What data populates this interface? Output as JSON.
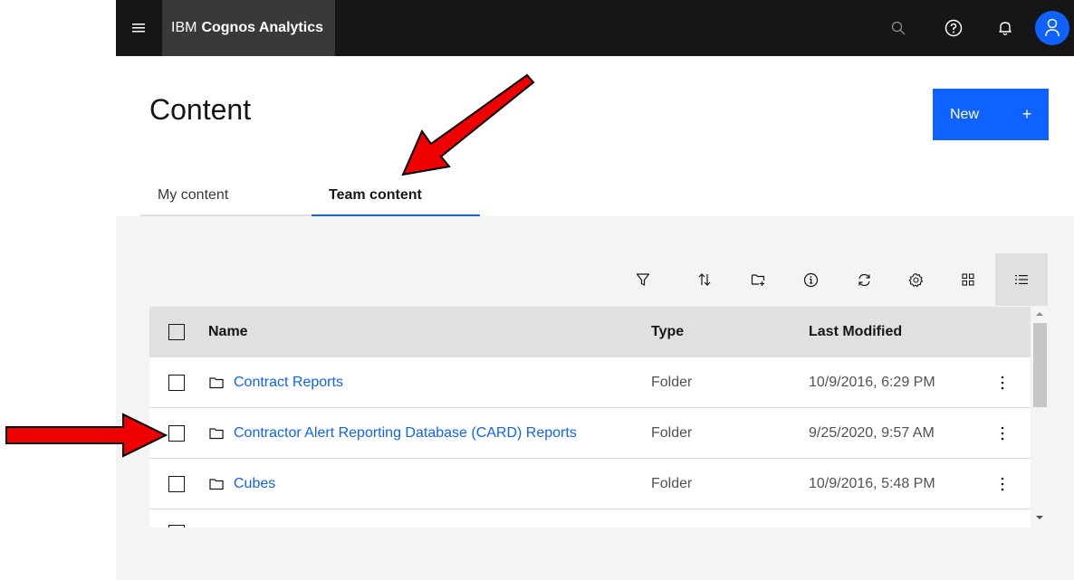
{
  "header": {
    "brand_prefix": "IBM",
    "brand_name": "Cognos Analytics"
  },
  "page": {
    "title": "Content",
    "new_button_label": "New",
    "new_button_icon": "+"
  },
  "tabs": [
    {
      "label": "My content",
      "selected": false
    },
    {
      "label": "Team content",
      "selected": true
    }
  ],
  "toolbar": {
    "icons": [
      "filter-icon",
      "sort-icon",
      "new-folder-icon",
      "info-icon",
      "refresh-icon",
      "settings-icon",
      "tile-view-icon",
      "list-view-icon"
    ],
    "active_view": "list"
  },
  "table": {
    "columns": [
      "Name",
      "Type",
      "Last Modified"
    ],
    "rows": [
      {
        "name": "Contract Reports",
        "type": "Folder",
        "modified": "10/9/2016, 6:29 PM"
      },
      {
        "name": "Contractor Alert Reporting Database (CARD) Reports",
        "type": "Folder",
        "modified": "9/25/2020, 9:57 AM"
      },
      {
        "name": "Cubes",
        "type": "Folder",
        "modified": "10/9/2016, 5:48 PM"
      }
    ]
  },
  "colors": {
    "header_bg": "#161616",
    "brand_bg": "#393939",
    "accent": "#0f62fe",
    "annotation_arrow": "#ee0000"
  }
}
